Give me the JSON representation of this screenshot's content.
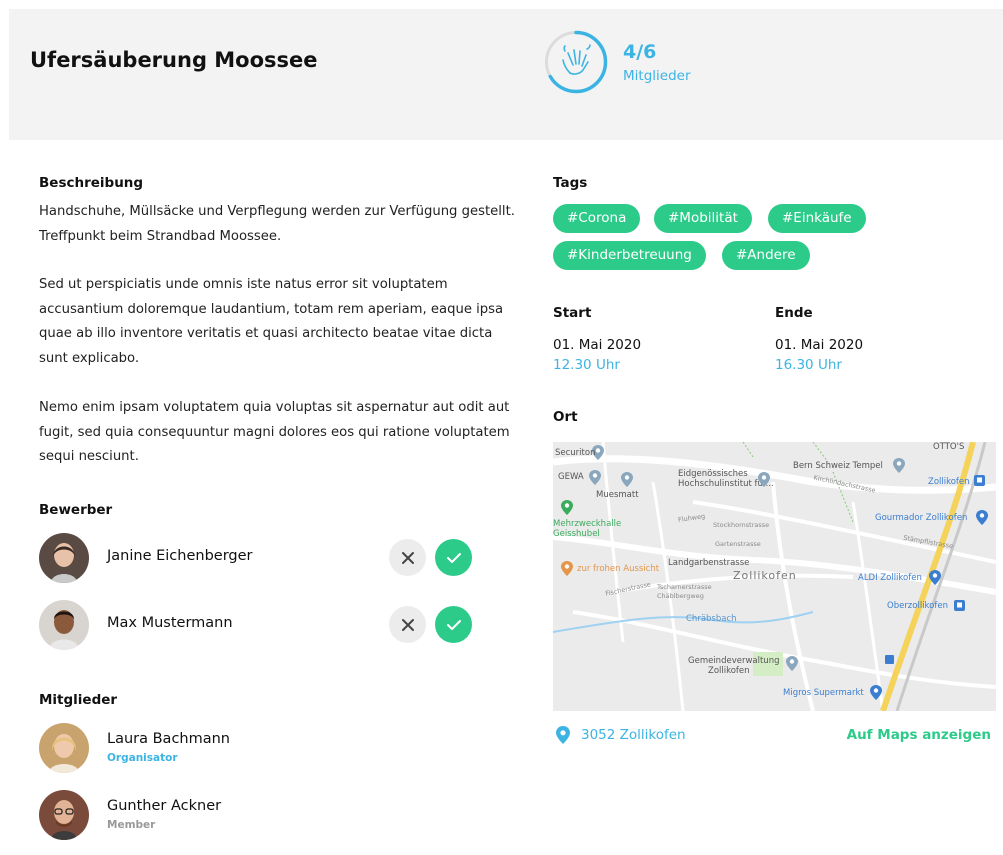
{
  "header": {
    "title": "Ufersäuberung Moossee",
    "counter": "4/6",
    "counter_label": "Mitglieder",
    "fraction_filled": 0.6667
  },
  "description": {
    "title": "Beschreibung",
    "paragraphs": [
      "Handschuhe, Müllsäcke und Verpflegung werden zur Verfügung gestellt. Treffpunkt beim Strandbad Moossee.",
      "Sed ut perspiciatis unde omnis iste natus error sit voluptatem accusantium doloremque laudantium, totam rem aperiam, eaque ipsa quae ab illo inventore veritatis et quasi architecto beatae vitae dicta sunt explicabo.",
      "Nemo enim ipsam voluptatem quia voluptas sit aspernatur aut odit aut fugit, sed quia consequuntur magni dolores eos qui ratione voluptatem sequi nesciunt."
    ]
  },
  "applicants": {
    "title": "Bewerber",
    "items": [
      {
        "name": "Janine Eichenberger"
      },
      {
        "name": "Max Mustermann"
      }
    ]
  },
  "members": {
    "title": "Mitglieder",
    "items": [
      {
        "name": "Laura Bachmann",
        "role": "Organisator",
        "role_color": "#3cb4e3"
      },
      {
        "name": "Gunther Ackner",
        "role": "Member",
        "role_color": "#999999"
      }
    ]
  },
  "tags": {
    "title": "Tags",
    "items": [
      "#Corona",
      "#Mobilität",
      "#Einkäufe",
      "#Kinderbetreuung",
      "#Andere"
    ]
  },
  "schedule": {
    "start_label": "Start",
    "start_date": "01. Mai 2020",
    "start_time": "12.30 Uhr",
    "end_label": "Ende",
    "end_date": "01. Mai 2020",
    "end_time": "16.30 Uhr"
  },
  "location": {
    "title": "Ort",
    "address": "3052 Zollikofen",
    "maps_link": "Auf Maps anzeigen",
    "map_labels": {
      "securiton": "Securiton",
      "gewa": "GEWA",
      "muesmatt": "Muesmatt",
      "eth_1": "Eidgenössisches",
      "eth_2": "Hochschulinstitut für...",
      "bern_tempel": "Bern Schweiz Tempel",
      "ottos": "OTTO'S",
      "zollikofen_station": "Zollikofen",
      "mehrzweck_1": "Mehrzweckhalle",
      "mehrzweck_2": "Geisshubel",
      "gourmador": "Gourmador Zollikofen",
      "aussicht": "zur frohen Aussicht",
      "landgarben": "Landgarbenstrasse",
      "zollikofen": "Zollikofen",
      "aldi": "ALDI Zollikofen",
      "oberzollikofen": "Oberzollikofen",
      "chraebsbach": "Chräbsbach",
      "gemeinde_1": "Gemeindeverwaltung",
      "gemeinde_2": "Zollikofen",
      "migros": "Migros Supermarkt",
      "kirchlindach": "Kirchlindachstrasse",
      "stampfli": "Stämpflistrasse",
      "gartenstrasse": "Gartenstrasse",
      "stockhorn": "Stockhornstrasse",
      "fischerstrasse": "Fischerstrasse",
      "tscharner": "Tscharnerstrasse",
      "chaeblberg": "Chäblbergweg",
      "fluhweg": "Fluhweg"
    }
  },
  "colors": {
    "accent_blue": "#3cb4e3",
    "accent_green": "#2dcb8a",
    "header_bg": "#f3f3f4"
  }
}
